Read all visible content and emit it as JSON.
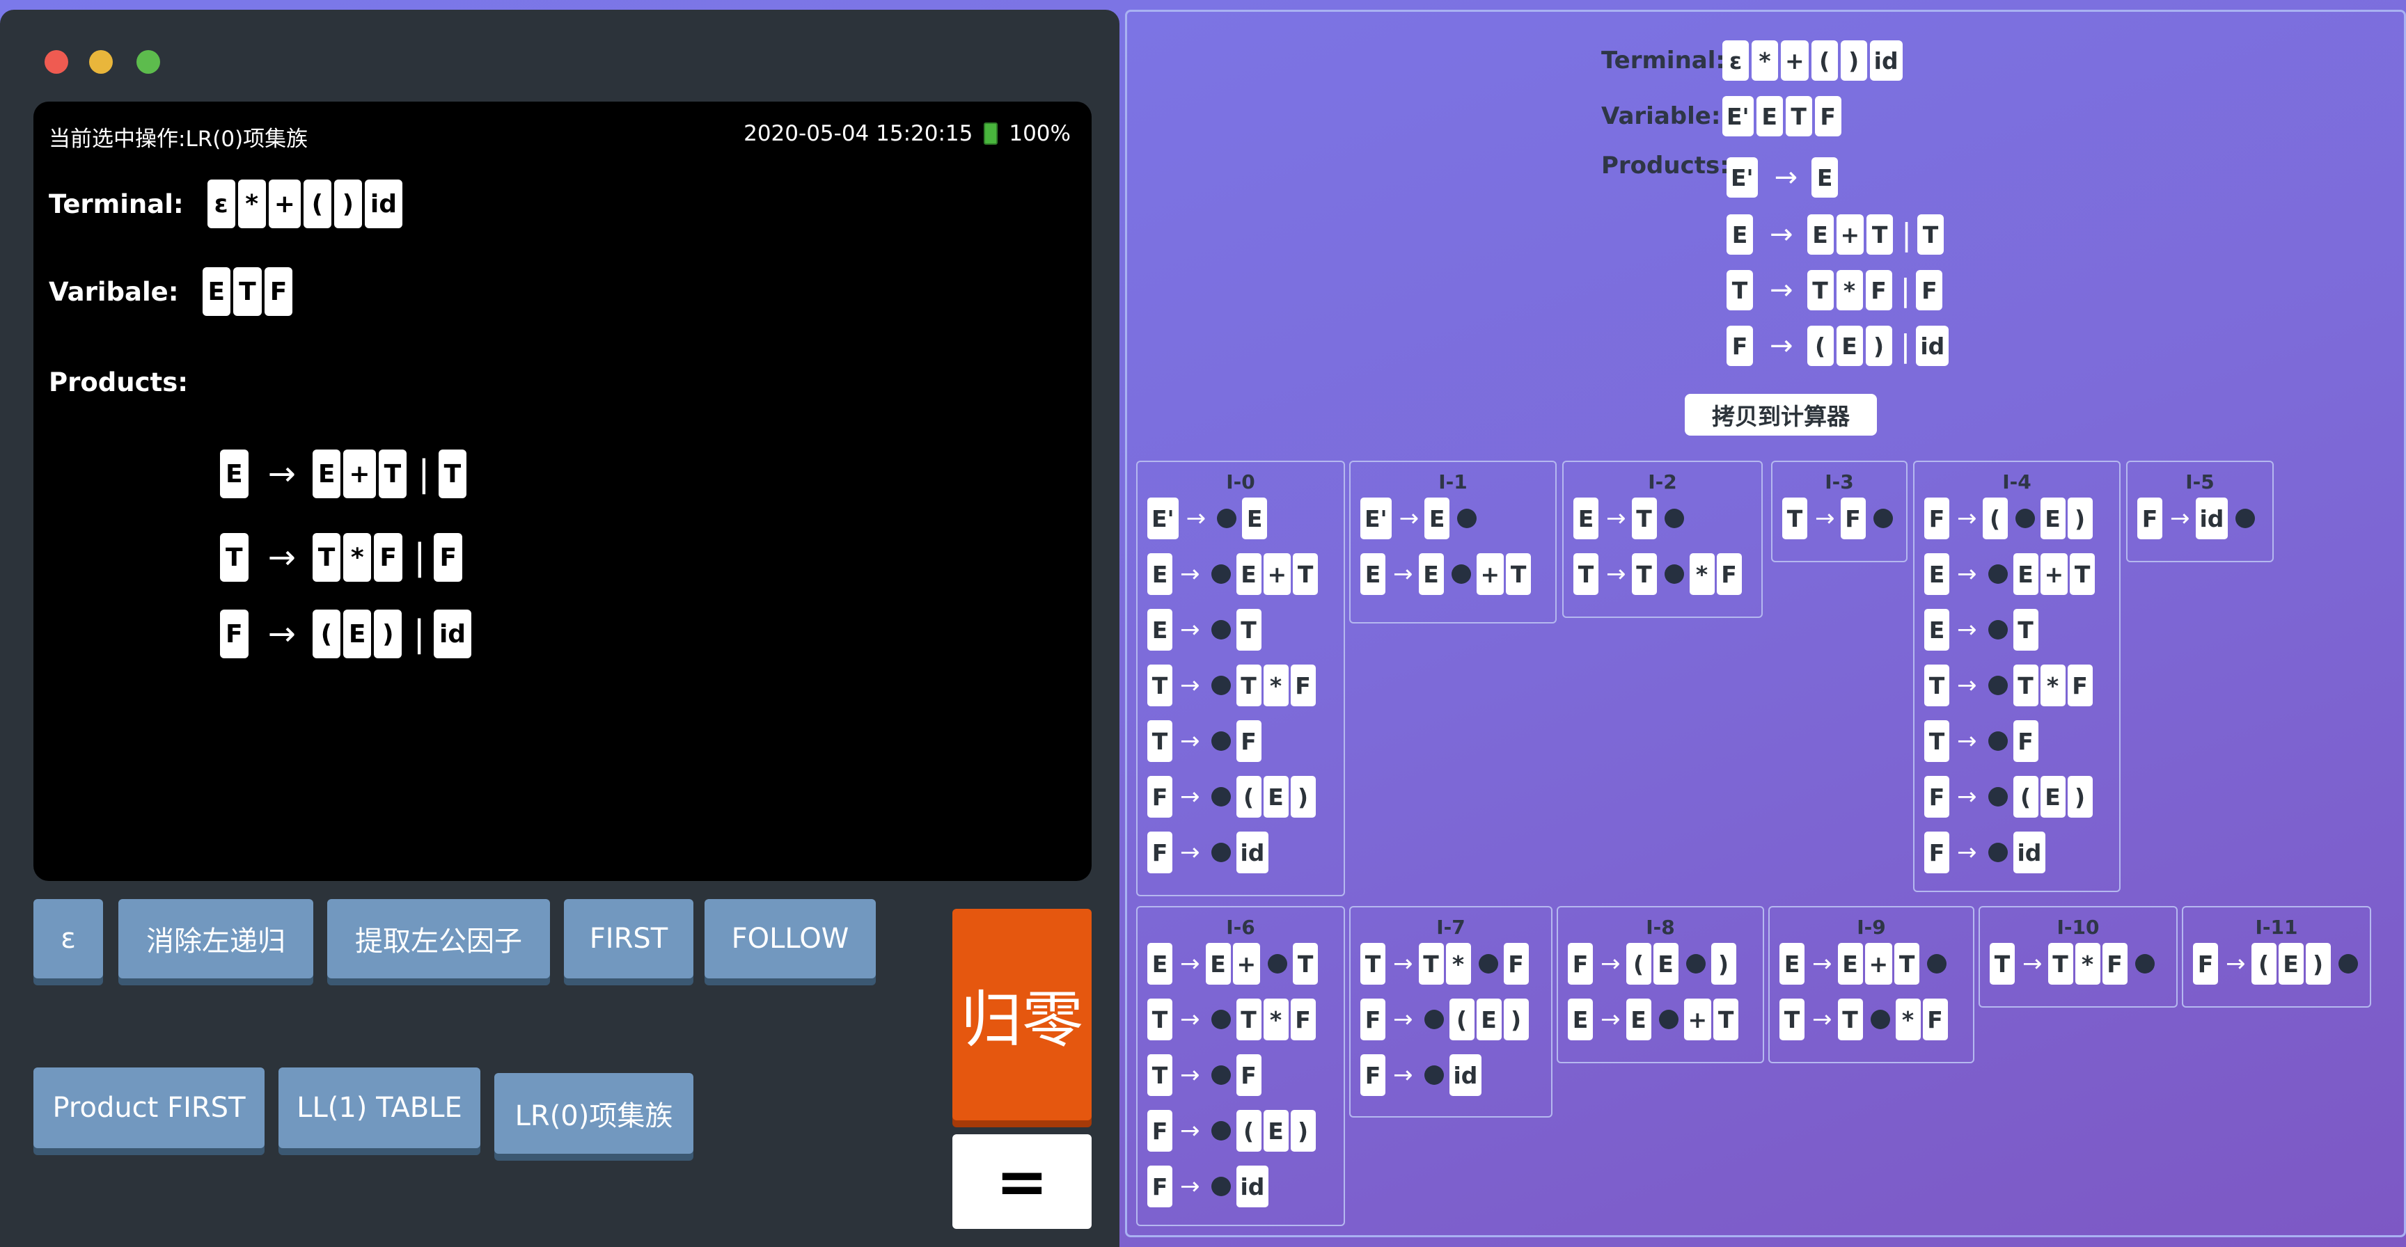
{
  "calculator": {
    "status_op": "当前选中操作:LR(0)项集族",
    "datetime": "2020-05-04 15:20:15",
    "battery": "100%",
    "terminal_label": "Terminal:",
    "terminals": [
      "ε",
      "*",
      "+",
      "(",
      ")",
      "id"
    ],
    "variable_label": "Varibale:",
    "variables": [
      "E",
      "T",
      "F"
    ],
    "products_label": "Products:",
    "products": [
      {
        "lhs": "E",
        "alts": [
          [
            "E",
            "+",
            "T"
          ],
          [
            "T"
          ]
        ]
      },
      {
        "lhs": "T",
        "alts": [
          [
            "T",
            "*",
            "F"
          ],
          [
            "F"
          ]
        ]
      },
      {
        "lhs": "F",
        "alts": [
          [
            "(",
            "E",
            ")"
          ],
          [
            "id"
          ]
        ]
      }
    ],
    "buttons": {
      "epsilon": "ε",
      "remove_left_recursion": "消除左递归",
      "left_factoring": "提取左公因子",
      "first": "FIRST",
      "follow": "FOLLOW",
      "product_first": "Product FIRST",
      "ll1_table": "LL(1) TABLE",
      "lr0_items": "LR(0)项集族",
      "zero": "归零",
      "equals": "="
    }
  },
  "grammar": {
    "terminal_label": "Terminal:",
    "terminals": [
      "ε",
      "*",
      "+",
      "(",
      ")",
      "id"
    ],
    "variable_label": "Variable:",
    "variables": [
      "E'",
      "E",
      "T",
      "F"
    ],
    "products_label": "Products:",
    "products": [
      {
        "lhs": "E'",
        "alts": [
          [
            "E"
          ]
        ]
      },
      {
        "lhs": "E",
        "alts": [
          [
            "E",
            "+",
            "T"
          ],
          [
            "T"
          ]
        ]
      },
      {
        "lhs": "T",
        "alts": [
          [
            "T",
            "*",
            "F"
          ],
          [
            "F"
          ]
        ]
      },
      {
        "lhs": "F",
        "alts": [
          [
            "(",
            "E",
            ")"
          ],
          [
            "id"
          ]
        ]
      }
    ],
    "copy_button": "拷贝到计算器"
  },
  "item_sets": [
    {
      "name": "I-0",
      "items": [
        [
          "E'",
          "•",
          "E"
        ],
        [
          "E",
          "•",
          "E",
          "+",
          "T"
        ],
        [
          "E",
          "•",
          "T"
        ],
        [
          "T",
          "•",
          "T",
          "*",
          "F"
        ],
        [
          "T",
          "•",
          "F"
        ],
        [
          "F",
          "•",
          "(",
          "E",
          ")"
        ],
        [
          "F",
          "•",
          "id"
        ]
      ]
    },
    {
      "name": "I-1",
      "items": [
        [
          "E'",
          "E",
          "•"
        ],
        [
          "E",
          "E",
          "•",
          "+",
          "T"
        ]
      ]
    },
    {
      "name": "I-2",
      "items": [
        [
          "E",
          "T",
          "•"
        ],
        [
          "T",
          "T",
          "•",
          "*",
          "F"
        ]
      ]
    },
    {
      "name": "I-3",
      "items": [
        [
          "T",
          "F",
          "•"
        ]
      ]
    },
    {
      "name": "I-4",
      "items": [
        [
          "F",
          "(",
          "•",
          "E",
          ")"
        ],
        [
          "E",
          "•",
          "E",
          "+",
          "T"
        ],
        [
          "E",
          "•",
          "T"
        ],
        [
          "T",
          "•",
          "T",
          "*",
          "F"
        ],
        [
          "T",
          "•",
          "F"
        ],
        [
          "F",
          "•",
          "(",
          "E",
          ")"
        ],
        [
          "F",
          "•",
          "id"
        ]
      ]
    },
    {
      "name": "I-5",
      "items": [
        [
          "F",
          "id",
          "•"
        ]
      ]
    },
    {
      "name": "I-6",
      "items": [
        [
          "E",
          "E",
          "+",
          "•",
          "T"
        ],
        [
          "T",
          "•",
          "T",
          "*",
          "F"
        ],
        [
          "T",
          "•",
          "F"
        ],
        [
          "F",
          "•",
          "(",
          "E",
          ")"
        ],
        [
          "F",
          "•",
          "id"
        ]
      ]
    },
    {
      "name": "I-7",
      "items": [
        [
          "T",
          "T",
          "*",
          "•",
          "F"
        ],
        [
          "F",
          "•",
          "(",
          "E",
          ")"
        ],
        [
          "F",
          "•",
          "id"
        ]
      ]
    },
    {
      "name": "I-8",
      "items": [
        [
          "F",
          "(",
          "E",
          "•",
          ")"
        ],
        [
          "E",
          "E",
          "•",
          "+",
          "T"
        ]
      ]
    },
    {
      "name": "I-9",
      "items": [
        [
          "E",
          "E",
          "+",
          "T",
          "•"
        ],
        [
          "T",
          "T",
          "•",
          "*",
          "F"
        ]
      ]
    },
    {
      "name": "I-10",
      "items": [
        [
          "T",
          "T",
          "*",
          "F",
          "•"
        ]
      ]
    },
    {
      "name": "I-11",
      "items": [
        [
          "F",
          "(",
          "E",
          ")",
          "•"
        ]
      ]
    }
  ]
}
